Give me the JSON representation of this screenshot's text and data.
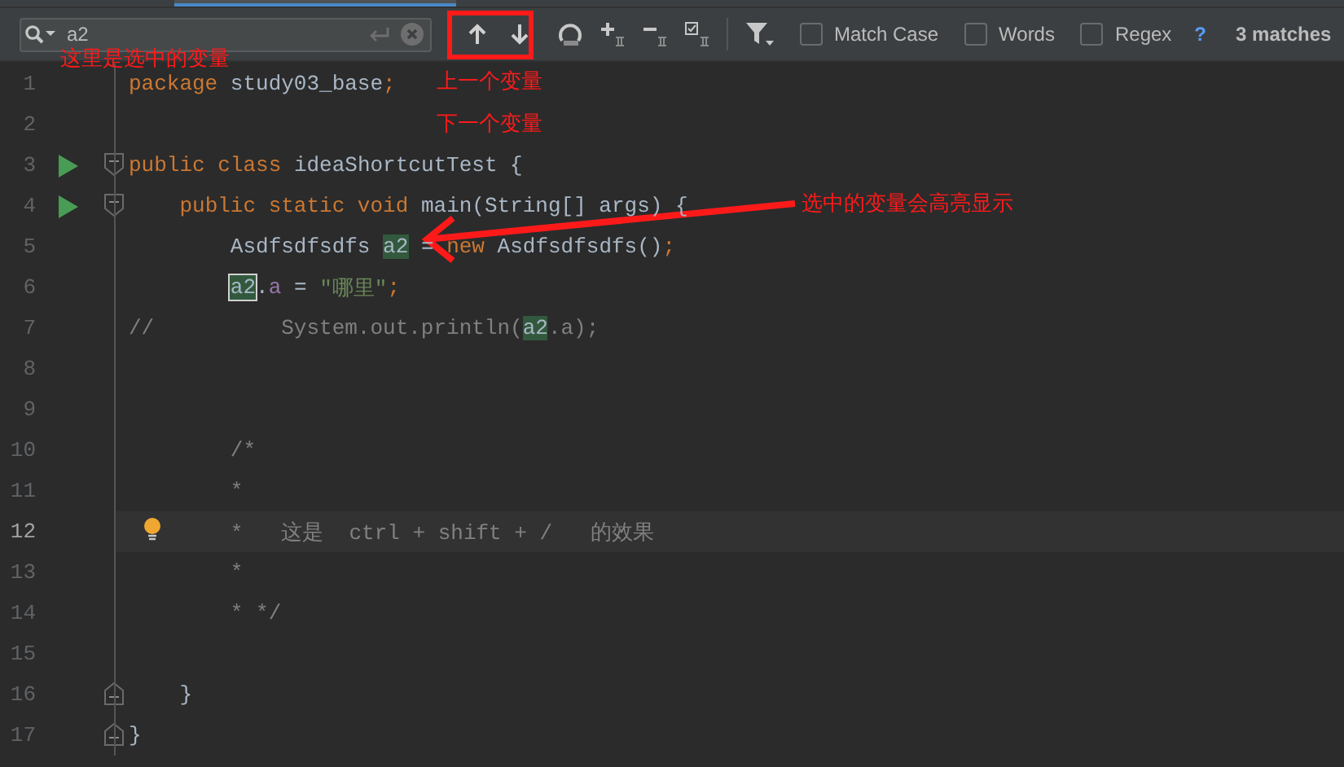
{
  "find_bar": {
    "query": "a2",
    "options": [
      {
        "label": "Match Case",
        "checked": false
      },
      {
        "label": "Words",
        "checked": false
      },
      {
        "label": "Regex",
        "checked": false
      }
    ],
    "help": "?",
    "result": "3 matches"
  },
  "editor": {
    "lines": [
      {
        "number": "1",
        "run": false,
        "current": false,
        "hint": false,
        "tokens": [
          {
            "kind": "keyword",
            "text": "package"
          },
          {
            "kind": "plain",
            "text": " study03_base"
          },
          {
            "kind": "keyword",
            "text": ";"
          }
        ]
      },
      {
        "number": "2",
        "run": false,
        "current": false,
        "hint": false
      },
      {
        "number": "3",
        "run": true,
        "fold_marker": {
          "kind": "start"
        },
        "current": false,
        "hint": false,
        "tokens": [
          {
            "kind": "keyword",
            "text": "public class"
          },
          {
            "kind": "plain",
            "text": " ideaShortcutTest {"
          }
        ]
      },
      {
        "number": "4",
        "run": true,
        "fold_marker": {
          "kind": "start"
        },
        "current": false,
        "hint": false,
        "tokens": [
          {
            "kind": "keyword",
            "text": "    public static void"
          },
          {
            "kind": "plain",
            "text": " main(String[] args) {"
          }
        ]
      },
      {
        "number": "5",
        "run": false,
        "current": false,
        "hint": false,
        "tokens": [
          {
            "kind": "plain",
            "text": "        Asdfsdfsdfs "
          },
          {
            "kind": "match",
            "selected": false,
            "text": "a2"
          },
          {
            "kind": "plain",
            "text": " = "
          },
          {
            "kind": "keyword",
            "text": "new"
          },
          {
            "kind": "plain",
            "text": " Asdfsdfsdfs()"
          },
          {
            "kind": "keyword",
            "text": ";"
          }
        ]
      },
      {
        "number": "6",
        "run": false,
        "current": false,
        "hint": false,
        "tokens": [
          {
            "kind": "match",
            "selected": true,
            "text": "        a2"
          },
          {
            "kind": "plain",
            "text": "."
          },
          {
            "kind": "field",
            "text": "a"
          },
          {
            "kind": "plain",
            "text": " = "
          },
          {
            "kind": "string",
            "text": "\"哪里\""
          },
          {
            "kind": "keyword",
            "text": ";"
          }
        ]
      },
      {
        "number": "7",
        "run": false,
        "current": false,
        "hint": false,
        "tokens": [
          {
            "kind": "comment",
            "text": "//          System.out.println("
          },
          {
            "kind": "match",
            "selected": false,
            "text": "a2"
          },
          {
            "kind": "comment",
            "text": ".a);"
          }
        ]
      },
      {
        "number": "8",
        "run": false,
        "current": false,
        "hint": false
      },
      {
        "number": "9",
        "run": false,
        "current": false,
        "hint": false
      },
      {
        "number": "10",
        "run": false,
        "current": false,
        "hint": false,
        "tokens": [
          {
            "kind": "comment",
            "text": "        /*"
          }
        ]
      },
      {
        "number": "11",
        "run": false,
        "current": false,
        "hint": false,
        "tokens": [
          {
            "kind": "comment",
            "text": "        *"
          }
        ]
      },
      {
        "number": "12",
        "run": false,
        "current": true,
        "hint": true,
        "tokens": [
          {
            "kind": "comment",
            "text": "        *   这是  ctrl + shift + /   的效果"
          }
        ]
      },
      {
        "number": "13",
        "run": false,
        "current": false,
        "hint": false,
        "tokens": [
          {
            "kind": "comment",
            "text": "        *"
          }
        ]
      },
      {
        "number": "14",
        "run": false,
        "current": false,
        "hint": false,
        "tokens": [
          {
            "kind": "comment",
            "text": "        * */"
          }
        ]
      },
      {
        "number": "15",
        "run": false,
        "current": false,
        "hint": false
      },
      {
        "number": "16",
        "run": false,
        "fold_marker": {
          "kind": "end"
        },
        "current": false,
        "hint": false,
        "tokens": [
          {
            "kind": "plain",
            "text": "    }"
          }
        ]
      },
      {
        "number": "17",
        "run": false,
        "fold_marker": {
          "kind": "end"
        },
        "current": false,
        "hint": false,
        "tokens": [
          {
            "kind": "plain",
            "text": "}"
          }
        ]
      }
    ]
  },
  "annotations": [
    {
      "text": "这里是选中的变量"
    },
    {
      "text": "上一个变量"
    },
    {
      "text": "下一个变量"
    },
    {
      "text": "选中的变量会高亮显示"
    }
  ]
}
